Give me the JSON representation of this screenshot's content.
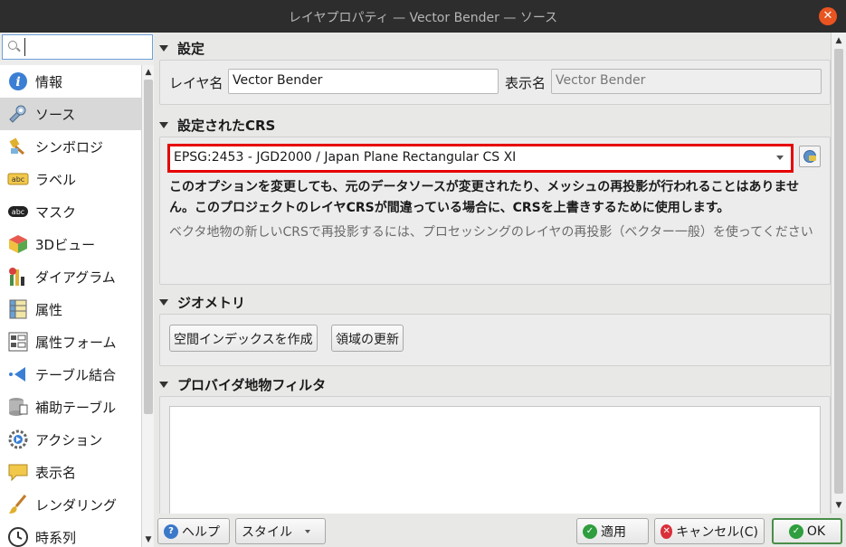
{
  "window": {
    "title": "レイヤプロパティ — Vector Bender — ソース",
    "close_glyph": "✕"
  },
  "sidebar": {
    "search_placeholder": "",
    "items": [
      {
        "label": "情報",
        "icon": "info-icon",
        "active": false
      },
      {
        "label": "ソース",
        "icon": "source-settings-icon",
        "active": true
      },
      {
        "label": "シンボロジ",
        "icon": "paintbrush-icon",
        "active": false
      },
      {
        "label": "ラベル",
        "icon": "abc-label-icon",
        "active": false
      },
      {
        "label": "マスク",
        "icon": "abc-mask-icon",
        "active": false
      },
      {
        "label": "3Dビュー",
        "icon": "cube-3d-icon",
        "active": false
      },
      {
        "label": "ダイアグラム",
        "icon": "diagram-icon",
        "active": false
      },
      {
        "label": "属性",
        "icon": "attribute-table-icon",
        "active": false
      },
      {
        "label": "属性フォーム",
        "icon": "attribute-form-icon",
        "active": false
      },
      {
        "label": "テーブル結合",
        "icon": "join-icon",
        "active": false
      },
      {
        "label": "補助テーブル",
        "icon": "auxiliary-storage-icon",
        "active": false
      },
      {
        "label": "アクション",
        "icon": "action-gear-icon",
        "active": false
      },
      {
        "label": "表示名",
        "icon": "speech-bubble-icon",
        "active": false
      },
      {
        "label": "レンダリング",
        "icon": "rendering-brush-icon",
        "active": false
      },
      {
        "label": "時系列",
        "icon": "clock-icon",
        "active": false
      }
    ]
  },
  "settings": {
    "header": "設定",
    "layer_name_label": "レイヤ名",
    "layer_name_value": "Vector Bender",
    "display_name_label": "表示名",
    "display_name_value": "Vector Bender"
  },
  "crs": {
    "header": "設定されたCRS",
    "selected": "EPSG:2453 - JGD2000 / Japan Plane Rectangular CS XI",
    "warning": "このオプションを変更しても、元のデータソースが変更されたり、メッシュの再投影が行われることはありません。このプロジェクトのレイヤCRSが間違っている場合に、CRSを上書きするために使用します。",
    "note": "ベクタ地物の新しいCRSで再投影するには、プロセッシングのレイヤの再投影（ベクター一般）を使ってください"
  },
  "geometry": {
    "header": "ジオメトリ",
    "create_index_button": "空間インデックスを作成",
    "update_extent_button": "領域の更新"
  },
  "filter": {
    "header": "プロバイダ地物フィルタ",
    "value": ""
  },
  "footer": {
    "help": "ヘルプ",
    "style": "スタイル",
    "apply": "適用",
    "cancel": "キャンセル(C)",
    "ok": "OK"
  },
  "colors": {
    "highlight_border": "#e60000",
    "title_close": "#e95420",
    "ok_icon": "#2e9e3e",
    "cancel_icon": "#d9303a",
    "help_icon": "#3a78c9"
  }
}
